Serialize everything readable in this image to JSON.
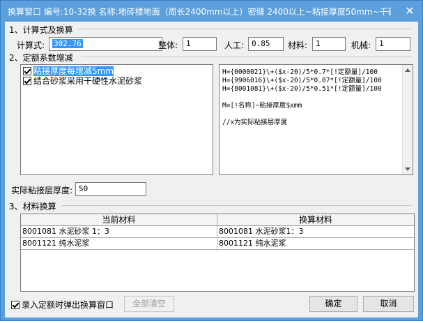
{
  "window": {
    "title": "换算窗口   编号:10-32换  名称:地砖楼地面（周长2400mm以上）密缝  2400以上~粘接厚度50mm~干硬...",
    "close_glyph": "✕"
  },
  "section1": {
    "title": "1、计算式及换算",
    "formula_label": "计算式:",
    "formula_value": "302.76",
    "whole_label": "整体:",
    "whole_value": "1",
    "labor_label": "人工:",
    "labor_value": "0.85",
    "material_label": "材料:",
    "material_value": "1",
    "machine_label": "机械:",
    "machine_value": "1"
  },
  "section2": {
    "title": "2、定额系数增减",
    "options": [
      {
        "label": "粘接厚度每增减5mm",
        "checked": true,
        "selected": true
      },
      {
        "label": "结合砂浆采用干硬性水泥砂浆",
        "checked": true,
        "selected": false
      }
    ],
    "formula_lines": [
      "H={0000021}\\+($x-20)/5*0.7*[!定额量]/100",
      "H={9906016}\\+($x-20)/5*0.07*[!定额量]/100",
      "H={8001081}\\+($x-20)/5*0.51*[!定额量]/100",
      "",
      "M=[!名称]~粘接厚度$xmm",
      "",
      "//x为实际粘接层厚度"
    ],
    "thickness_label": "实际粘接层厚度:",
    "thickness_value": "50"
  },
  "section3": {
    "title": "3、材料换算",
    "columns": [
      "当前材料",
      "换算材料"
    ],
    "rows": [
      [
        "8001081 水泥砂浆 1：3",
        "8001081 水泥砂浆1：3"
      ],
      [
        "8001121 纯水泥浆",
        "8001121 纯水泥浆"
      ]
    ]
  },
  "footer": {
    "popup_checkbox_label": "录入定额时弹出换算窗口",
    "popup_checked": true,
    "clear_all": "全部清空",
    "ok": "确定",
    "cancel": "取消"
  }
}
